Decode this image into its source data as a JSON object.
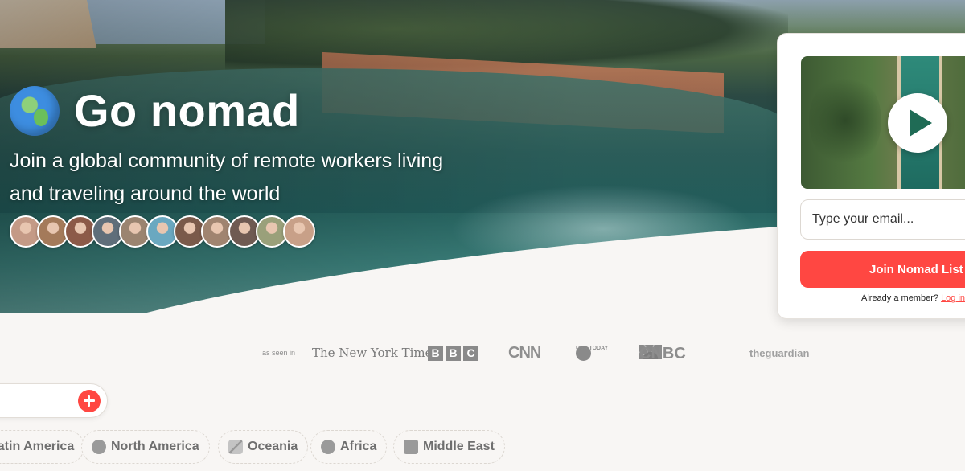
{
  "hero": {
    "title": "Go nomad",
    "subtitle": "Join a global community of remote workers living and traveling around the world",
    "avatars": [
      {
        "color": "#c49a86"
      },
      {
        "color": "#a47a5a"
      },
      {
        "color": "#8c5a48"
      },
      {
        "color": "#5f6e7a"
      },
      {
        "color": "#9b8470"
      },
      {
        "color": "#6aa8c0"
      },
      {
        "color": "#7a5a4a"
      },
      {
        "color": "#a08470"
      },
      {
        "color": "#6f5a52"
      },
      {
        "color": "#9aa07a"
      },
      {
        "color": "#c8a088"
      }
    ]
  },
  "signup": {
    "email_placeholder": "Type your email...",
    "join_label": "Join Nomad List",
    "member_text": "Already a member?",
    "login_label": "Log in"
  },
  "press": {
    "label": "as seen in",
    "nyt": "The New York Times",
    "bbc": [
      "B",
      "B",
      "C"
    ],
    "cnn": "CNN",
    "usatoday": "USA TODAY",
    "cnbc": "CNBC",
    "guardian": "theguardian"
  },
  "filters": [
    {
      "label": "Latin America",
      "icon": "globe-icon"
    },
    {
      "label": "North America",
      "icon": "globe-icon"
    },
    {
      "label": "Oceania",
      "icon": "plane-icon"
    },
    {
      "label": "Africa",
      "icon": "globe-icon"
    },
    {
      "label": "Middle East",
      "icon": "mosque-icon"
    }
  ],
  "colors": {
    "accent": "#ff4742",
    "background": "#f8f6f4",
    "muted_text": "#6f6f6f"
  }
}
